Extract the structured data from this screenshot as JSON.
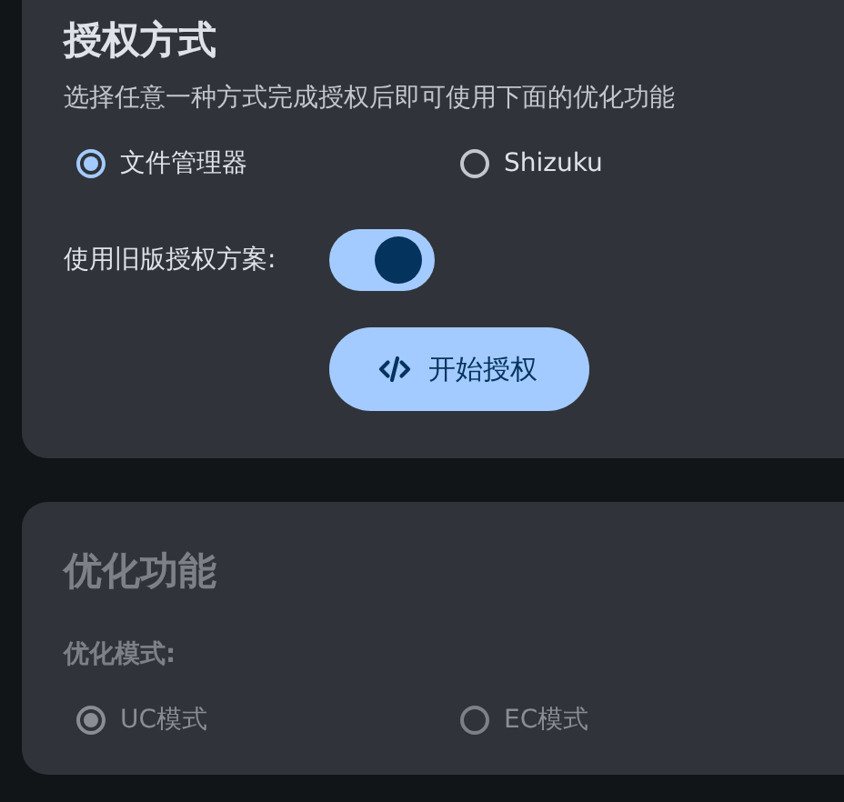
{
  "auth": {
    "title": "授权方式",
    "description": "选择任意一种方式完成授权后即可使用下面的优化功能",
    "methods": [
      {
        "label": "文件管理器",
        "selected": true
      },
      {
        "label": "Shizuku",
        "selected": false
      }
    ],
    "legacy": {
      "label": "使用旧版授权方案:",
      "on": true
    },
    "button": {
      "label": "开始授权"
    }
  },
  "optimize": {
    "title": "优化功能",
    "disabled": true,
    "mode_label": "优化模式:",
    "modes": [
      {
        "label": "UC模式",
        "selected": true
      },
      {
        "label": "EC模式",
        "selected": false
      }
    ]
  }
}
